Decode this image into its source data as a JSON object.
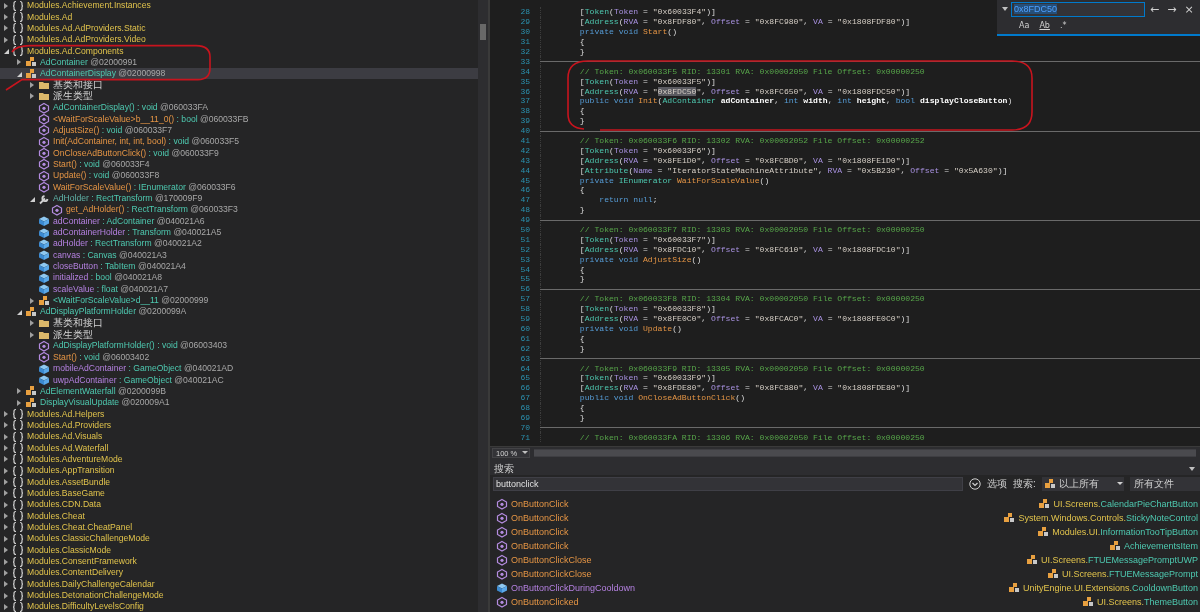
{
  "tree": [
    {
      "kind": "namespace",
      "name": "Modules.Achievement.Instances",
      "expanded": false,
      "selected": false
    },
    {
      "kind": "namespace",
      "name": "Modules.Ad",
      "expanded": false,
      "selected": false
    },
    {
      "kind": "namespace",
      "name": "Modules.Ad.AdProviders.Static",
      "expanded": false,
      "selected": false
    },
    {
      "kind": "namespace",
      "name": "Modules.Ad.AdProviders.Video",
      "expanded": false,
      "selected": false
    },
    {
      "kind": "namespace",
      "name": "Modules.Ad.Components",
      "expanded": true,
      "selected": false,
      "children": [
        {
          "kind": "class",
          "name": "AdContainer",
          "token": "@02000991",
          "expanded": false,
          "selected": false
        },
        {
          "kind": "class",
          "name": "AdContainerDisplay",
          "token": "@02000998",
          "expanded": true,
          "selected": true,
          "children": [
            {
              "kind": "folder",
              "name": "基类和接口",
              "expanded": false,
              "selected": false
            },
            {
              "kind": "folder",
              "name": "派生类型",
              "expanded": false,
              "selected": false
            },
            {
              "kind": "constructor",
              "name": "AdContainerDisplay()",
              "type": ": void",
              "token": "@060033FA",
              "selected": false
            },
            {
              "kind": "method",
              "name": "<WaitForScaleValue>b__11_0()",
              "type": ": bool",
              "token": "@060033FB",
              "selected": false
            },
            {
              "kind": "method",
              "name": "AdjustSize()",
              "type": ": void",
              "token": "@060033F7",
              "selected": false
            },
            {
              "kind": "method",
              "name": "Init(AdContainer, int, int, bool)",
              "type": ": void",
              "token": "@060033F5",
              "selected": false
            },
            {
              "kind": "method",
              "name": "OnCloseAdButtonClick()",
              "type": ": void",
              "token": "@060033F9",
              "selected": false
            },
            {
              "kind": "method",
              "name": "Start()",
              "type": ": void",
              "token": "@060033F4",
              "selected": false
            },
            {
              "kind": "method",
              "name": "Update()",
              "type": ": void",
              "token": "@060033F8",
              "selected": false
            },
            {
              "kind": "method",
              "name": "WaitForScaleValue()",
              "type": ": IEnumerator",
              "token": "@060033F6",
              "selected": false
            },
            {
              "kind": "property",
              "name": "AdHolder",
              "type": ": RectTransform",
              "token": "@170009F9",
              "expanded": true,
              "selected": false,
              "children": [
                {
                  "kind": "method",
                  "name": "get_AdHolder()",
                  "type": ": RectTransform",
                  "token": "@060033F3",
                  "selected": false
                }
              ]
            },
            {
              "kind": "field",
              "name": "adContainer",
              "type": ": AdContainer",
              "token": "@040021A6",
              "selected": false
            },
            {
              "kind": "field",
              "name": "adContainerHolder",
              "type": ": Transform",
              "token": "@040021A5",
              "selected": false
            },
            {
              "kind": "field",
              "name": "adHolder",
              "type": ": RectTransform",
              "token": "@040021A2",
              "selected": false
            },
            {
              "kind": "field",
              "name": "canvas",
              "type": ": Canvas",
              "token": "@040021A3",
              "selected": false
            },
            {
              "kind": "field",
              "name": "closeButton",
              "type": ": TabItem",
              "token": "@040021A4",
              "selected": false
            },
            {
              "kind": "field",
              "name": "initialized",
              "type": ": bool",
              "token": "@040021A8",
              "selected": false
            },
            {
              "kind": "field",
              "name": "scaleValue",
              "type": ": float",
              "token": "@040021A7",
              "selected": false
            },
            {
              "kind": "nested",
              "name": "<WaitForScaleValue>d__11",
              "token": "@02000999",
              "expanded": false,
              "selected": false
            }
          ]
        },
        {
          "kind": "class",
          "name": "AdDisplayPlatformHolder",
          "token": "@0200099A",
          "expanded": true,
          "selected": false,
          "children": [
            {
              "kind": "folder",
              "name": "基类和接口",
              "expanded": false,
              "selected": false
            },
            {
              "kind": "folder",
              "name": "派生类型",
              "expanded": false,
              "selected": false
            },
            {
              "kind": "constructor",
              "name": "AdDisplayPlatformHolder()",
              "type": ": void",
              "token": "@06003403",
              "selected": false
            },
            {
              "kind": "method",
              "name": "Start()",
              "type": ": void",
              "token": "@06003402",
              "selected": false
            },
            {
              "kind": "field",
              "name": "mobileAdContainer",
              "type": ": GameObject",
              "token": "@040021AD",
              "selected": false
            },
            {
              "kind": "field",
              "name": "uwpAdContainer",
              "type": ": GameObject",
              "token": "@040021AC",
              "selected": false
            }
          ]
        },
        {
          "kind": "class",
          "name": "AdElementWaterfall",
          "token": "@0200099B",
          "expanded": false,
          "selected": false
        },
        {
          "kind": "class",
          "name": "DisplayVisualUpdate",
          "token": "@020009A1",
          "expanded": false,
          "selected": false
        }
      ]
    },
    {
      "kind": "namespace",
      "name": "Modules.Ad.Helpers",
      "expanded": false,
      "selected": false
    },
    {
      "kind": "namespace",
      "name": "Modules.Ad.Providers",
      "expanded": false,
      "selected": false
    },
    {
      "kind": "namespace",
      "name": "Modules.Ad.Visuals",
      "expanded": false,
      "selected": false
    },
    {
      "kind": "namespace",
      "name": "Modules.Ad.Waterfall",
      "expanded": false,
      "selected": false
    },
    {
      "kind": "namespace",
      "name": "Modules.AdventureMode",
      "expanded": false,
      "selected": false
    },
    {
      "kind": "namespace",
      "name": "Modules.AppTransition",
      "expanded": false,
      "selected": false
    },
    {
      "kind": "namespace",
      "name": "Modules.AssetBundle",
      "expanded": false,
      "selected": false
    },
    {
      "kind": "namespace",
      "name": "Modules.BaseGame",
      "expanded": false,
      "selected": false
    },
    {
      "kind": "namespace",
      "name": "Modules.CDN.Data",
      "expanded": false,
      "selected": false
    },
    {
      "kind": "namespace",
      "name": "Modules.Cheat",
      "expanded": false,
      "selected": false
    },
    {
      "kind": "namespace",
      "name": "Modules.Cheat.CheatPanel",
      "expanded": false,
      "selected": false
    },
    {
      "kind": "namespace",
      "name": "Modules.ClassicChallengeMode",
      "expanded": false,
      "selected": false
    },
    {
      "kind": "namespace",
      "name": "Modules.ClassicMode",
      "expanded": false,
      "selected": false
    },
    {
      "kind": "namespace",
      "name": "Modules.ConsentFramework",
      "expanded": false,
      "selected": false
    },
    {
      "kind": "namespace",
      "name": "Modules.ContentDelivery",
      "expanded": false,
      "selected": false
    },
    {
      "kind": "namespace",
      "name": "Modules.DailyChallengeCalendar",
      "expanded": false,
      "selected": false
    },
    {
      "kind": "namespace",
      "name": "Modules.DetonationChallengeMode",
      "expanded": false,
      "selected": false
    },
    {
      "kind": "namespace",
      "name": "Modules.DifficultyLevelsConfig",
      "expanded": false,
      "selected": false
    }
  ],
  "code": {
    "lines": [
      {
        "number": "28",
        "tokens": [
          {
            "kind": "plain",
            "text": "        ["
          },
          {
            "kind": "type",
            "text": "Token"
          },
          {
            "kind": "plain",
            "text": "("
          },
          {
            "kind": "arg",
            "text": "Token"
          },
          {
            "kind": "plain",
            "text": " = "
          },
          {
            "kind": "string",
            "text": "\"0x60033F4\""
          },
          {
            "kind": "plain",
            "text": ")]"
          }
        ]
      },
      {
        "number": "29",
        "tokens": [
          {
            "kind": "plain",
            "text": "        ["
          },
          {
            "kind": "type",
            "text": "Address"
          },
          {
            "kind": "plain",
            "text": "("
          },
          {
            "kind": "arg",
            "text": "RVA"
          },
          {
            "kind": "plain",
            "text": " = "
          },
          {
            "kind": "string",
            "text": "\"0x8FDF80\""
          },
          {
            "kind": "plain",
            "text": ", "
          },
          {
            "kind": "arg",
            "text": "Offset"
          },
          {
            "kind": "plain",
            "text": " = "
          },
          {
            "kind": "string",
            "text": "\"0x8FC980\""
          },
          {
            "kind": "plain",
            "text": ", "
          },
          {
            "kind": "arg",
            "text": "VA"
          },
          {
            "kind": "plain",
            "text": " = "
          },
          {
            "kind": "string",
            "text": "\"0x1808FDF80\""
          },
          {
            "kind": "plain",
            "text": ")]"
          }
        ]
      },
      {
        "number": "30",
        "tokens": [
          {
            "kind": "keyword",
            "text": "        private void "
          },
          {
            "kind": "method",
            "text": "Start"
          },
          {
            "kind": "plain",
            "text": "()"
          }
        ]
      },
      {
        "number": "31",
        "tokens": [
          {
            "kind": "plain",
            "text": "        {"
          }
        ]
      },
      {
        "number": "32",
        "tokens": [
          {
            "kind": "plain",
            "text": "        }"
          }
        ]
      },
      {
        "number": "33",
        "separator": true
      },
      {
        "number": "34",
        "tokens": [
          {
            "kind": "comment",
            "text": "        // Token: 0x060033F5 RID: 13301 RVA: 0x00002050 File Offset: 0x00000250"
          }
        ]
      },
      {
        "number": "35",
        "tokens": [
          {
            "kind": "plain",
            "text": "        ["
          },
          {
            "kind": "type",
            "text": "Token"
          },
          {
            "kind": "plain",
            "text": "("
          },
          {
            "kind": "arg",
            "text": "Token"
          },
          {
            "kind": "plain",
            "text": " = "
          },
          {
            "kind": "string",
            "text": "\"0x60033F5\""
          },
          {
            "kind": "plain",
            "text": ")]"
          }
        ]
      },
      {
        "number": "36",
        "tokens": [
          {
            "kind": "plain",
            "text": "        ["
          },
          {
            "kind": "type",
            "text": "Address"
          },
          {
            "kind": "plain",
            "text": "("
          },
          {
            "kind": "arg",
            "text": "RVA"
          },
          {
            "kind": "plain",
            "text": " = "
          },
          {
            "kind": "string",
            "text": "\""
          },
          {
            "kind": "match",
            "text": "0x8FDC50"
          },
          {
            "kind": "string",
            "text": "\""
          },
          {
            "kind": "plain",
            "text": ", "
          },
          {
            "kind": "arg",
            "text": "Offset"
          },
          {
            "kind": "plain",
            "text": " = "
          },
          {
            "kind": "string",
            "text": "\"0x8FC650\""
          },
          {
            "kind": "plain",
            "text": ", "
          },
          {
            "kind": "arg",
            "text": "VA"
          },
          {
            "kind": "plain",
            "text": " = "
          },
          {
            "kind": "string",
            "text": "\"0x1808FDC50\""
          },
          {
            "kind": "plain",
            "text": ")]"
          }
        ]
      },
      {
        "number": "37",
        "tokens": [
          {
            "kind": "keyword",
            "text": "        public void "
          },
          {
            "kind": "method",
            "text": "Init"
          },
          {
            "kind": "plain",
            "text": "("
          },
          {
            "kind": "type",
            "text": "AdContainer"
          },
          {
            "kind": "param",
            "text": " adContainer"
          },
          {
            "kind": "plain",
            "text": ", "
          },
          {
            "kind": "keyword",
            "text": "int"
          },
          {
            "kind": "param",
            "text": " width"
          },
          {
            "kind": "plain",
            "text": ", "
          },
          {
            "kind": "keyword",
            "text": "int"
          },
          {
            "kind": "param",
            "text": " height"
          },
          {
            "kind": "plain",
            "text": ", "
          },
          {
            "kind": "keyword",
            "text": "bool"
          },
          {
            "kind": "param",
            "text": " displayCloseButton"
          },
          {
            "kind": "plain",
            "text": ")"
          }
        ]
      },
      {
        "number": "38",
        "tokens": [
          {
            "kind": "plain",
            "text": "        {"
          }
        ]
      },
      {
        "number": "39",
        "tokens": [
          {
            "kind": "plain",
            "text": "        }"
          }
        ]
      },
      {
        "number": "40",
        "separator": true
      },
      {
        "number": "41",
        "tokens": [
          {
            "kind": "comment",
            "text": "        // Token: 0x060033F6 RID: 13302 RVA: 0x00002052 File Offset: 0x00000252"
          }
        ]
      },
      {
        "number": "42",
        "tokens": [
          {
            "kind": "plain",
            "text": "        ["
          },
          {
            "kind": "type",
            "text": "Token"
          },
          {
            "kind": "plain",
            "text": "("
          },
          {
            "kind": "arg",
            "text": "Token"
          },
          {
            "kind": "plain",
            "text": " = "
          },
          {
            "kind": "string",
            "text": "\"0x60033F6\""
          },
          {
            "kind": "plain",
            "text": ")]"
          }
        ]
      },
      {
        "number": "43",
        "tokens": [
          {
            "kind": "plain",
            "text": "        ["
          },
          {
            "kind": "type",
            "text": "Address"
          },
          {
            "kind": "plain",
            "text": "("
          },
          {
            "kind": "arg",
            "text": "RVA"
          },
          {
            "kind": "plain",
            "text": " = "
          },
          {
            "kind": "string",
            "text": "\"0x8FE1D0\""
          },
          {
            "kind": "plain",
            "text": ", "
          },
          {
            "kind": "arg",
            "text": "Offset"
          },
          {
            "kind": "plain",
            "text": " = "
          },
          {
            "kind": "string",
            "text": "\"0x8FCBD0\""
          },
          {
            "kind": "plain",
            "text": ", "
          },
          {
            "kind": "arg",
            "text": "VA"
          },
          {
            "kind": "plain",
            "text": " = "
          },
          {
            "kind": "string",
            "text": "\"0x1808FE1D0\""
          },
          {
            "kind": "plain",
            "text": ")]"
          }
        ]
      },
      {
        "number": "44",
        "tokens": [
          {
            "kind": "plain",
            "text": "        ["
          },
          {
            "kind": "type",
            "text": "Attribute"
          },
          {
            "kind": "plain",
            "text": "("
          },
          {
            "kind": "arg",
            "text": "Name"
          },
          {
            "kind": "plain",
            "text": " = "
          },
          {
            "kind": "string",
            "text": "\"IteratorStateMachineAttribute\""
          },
          {
            "kind": "plain",
            "text": ", "
          },
          {
            "kind": "arg",
            "text": "RVA"
          },
          {
            "kind": "plain",
            "text": " = "
          },
          {
            "kind": "string",
            "text": "\"0x5B230\""
          },
          {
            "kind": "plain",
            "text": ", "
          },
          {
            "kind": "arg",
            "text": "Offset"
          },
          {
            "kind": "plain",
            "text": " = "
          },
          {
            "kind": "string",
            "text": "\"0x5A630\""
          },
          {
            "kind": "plain",
            "text": ")]"
          }
        ]
      },
      {
        "number": "45",
        "tokens": [
          {
            "kind": "keyword",
            "text": "        private "
          },
          {
            "kind": "type",
            "text": "IEnumerator "
          },
          {
            "kind": "method",
            "text": "WaitForScaleValue"
          },
          {
            "kind": "plain",
            "text": "()"
          }
        ]
      },
      {
        "number": "46",
        "tokens": [
          {
            "kind": "plain",
            "text": "        {"
          }
        ]
      },
      {
        "number": "47",
        "tokens": [
          {
            "kind": "keyword",
            "text": "            return null"
          },
          {
            "kind": "plain",
            "text": ";"
          }
        ]
      },
      {
        "number": "48",
        "tokens": [
          {
            "kind": "plain",
            "text": "        }"
          }
        ]
      },
      {
        "number": "49",
        "separator": true
      },
      {
        "number": "50",
        "tokens": [
          {
            "kind": "comment",
            "text": "        // Token: 0x060033F7 RID: 13303 RVA: 0x00002050 File Offset: 0x00000250"
          }
        ]
      },
      {
        "number": "51",
        "tokens": [
          {
            "kind": "plain",
            "text": "        ["
          },
          {
            "kind": "type",
            "text": "Token"
          },
          {
            "kind": "plain",
            "text": "("
          },
          {
            "kind": "arg",
            "text": "Token"
          },
          {
            "kind": "plain",
            "text": " = "
          },
          {
            "kind": "string",
            "text": "\"0x60033F7\""
          },
          {
            "kind": "plain",
            "text": ")]"
          }
        ]
      },
      {
        "number": "52",
        "tokens": [
          {
            "kind": "plain",
            "text": "        ["
          },
          {
            "kind": "type",
            "text": "Address"
          },
          {
            "kind": "plain",
            "text": "("
          },
          {
            "kind": "arg",
            "text": "RVA"
          },
          {
            "kind": "plain",
            "text": " = "
          },
          {
            "kind": "string",
            "text": "\"0x8FDC10\""
          },
          {
            "kind": "plain",
            "text": ", "
          },
          {
            "kind": "arg",
            "text": "Offset"
          },
          {
            "kind": "plain",
            "text": " = "
          },
          {
            "kind": "string",
            "text": "\"0x8FC610\""
          },
          {
            "kind": "plain",
            "text": ", "
          },
          {
            "kind": "arg",
            "text": "VA"
          },
          {
            "kind": "plain",
            "text": " = "
          },
          {
            "kind": "string",
            "text": "\"0x1808FDC10\""
          },
          {
            "kind": "plain",
            "text": ")]"
          }
        ]
      },
      {
        "number": "53",
        "tokens": [
          {
            "kind": "keyword",
            "text": "        private void "
          },
          {
            "kind": "method",
            "text": "AdjustSize"
          },
          {
            "kind": "plain",
            "text": "()"
          }
        ]
      },
      {
        "number": "54",
        "tokens": [
          {
            "kind": "plain",
            "text": "        {"
          }
        ]
      },
      {
        "number": "55",
        "tokens": [
          {
            "kind": "plain",
            "text": "        }"
          }
        ]
      },
      {
        "number": "56",
        "separator": true
      },
      {
        "number": "57",
        "tokens": [
          {
            "kind": "comment",
            "text": "        // Token: 0x060033F8 RID: 13304 RVA: 0x00002050 File Offset: 0x00000250"
          }
        ]
      },
      {
        "number": "58",
        "tokens": [
          {
            "kind": "plain",
            "text": "        ["
          },
          {
            "kind": "type",
            "text": "Token"
          },
          {
            "kind": "plain",
            "text": "("
          },
          {
            "kind": "arg",
            "text": "Token"
          },
          {
            "kind": "plain",
            "text": " = "
          },
          {
            "kind": "string",
            "text": "\"0x60033F8\""
          },
          {
            "kind": "plain",
            "text": ")]"
          }
        ]
      },
      {
        "number": "59",
        "tokens": [
          {
            "kind": "plain",
            "text": "        ["
          },
          {
            "kind": "type",
            "text": "Address"
          },
          {
            "kind": "plain",
            "text": "("
          },
          {
            "kind": "arg",
            "text": "RVA"
          },
          {
            "kind": "plain",
            "text": " = "
          },
          {
            "kind": "string",
            "text": "\"0x8FE0C0\""
          },
          {
            "kind": "plain",
            "text": ", "
          },
          {
            "kind": "arg",
            "text": "Offset"
          },
          {
            "kind": "plain",
            "text": " = "
          },
          {
            "kind": "string",
            "text": "\"0x8FCAC0\""
          },
          {
            "kind": "plain",
            "text": ", "
          },
          {
            "kind": "arg",
            "text": "VA"
          },
          {
            "kind": "plain",
            "text": " = "
          },
          {
            "kind": "string",
            "text": "\"0x1808FE0C0\""
          },
          {
            "kind": "plain",
            "text": ")]"
          }
        ]
      },
      {
        "number": "60",
        "tokens": [
          {
            "kind": "keyword",
            "text": "        private void "
          },
          {
            "kind": "method",
            "text": "Update"
          },
          {
            "kind": "plain",
            "text": "()"
          }
        ]
      },
      {
        "number": "61",
        "tokens": [
          {
            "kind": "plain",
            "text": "        {"
          }
        ]
      },
      {
        "number": "62",
        "tokens": [
          {
            "kind": "plain",
            "text": "        }"
          }
        ]
      },
      {
        "number": "63",
        "separator": true
      },
      {
        "number": "64",
        "tokens": [
          {
            "kind": "comment",
            "text": "        // Token: 0x060033F9 RID: 13305 RVA: 0x00002050 File Offset: 0x00000250"
          }
        ]
      },
      {
        "number": "65",
        "tokens": [
          {
            "kind": "plain",
            "text": "        ["
          },
          {
            "kind": "type",
            "text": "Token"
          },
          {
            "kind": "plain",
            "text": "("
          },
          {
            "kind": "arg",
            "text": "Token"
          },
          {
            "kind": "plain",
            "text": " = "
          },
          {
            "kind": "string",
            "text": "\"0x60033F9\""
          },
          {
            "kind": "plain",
            "text": ")]"
          }
        ]
      },
      {
        "number": "66",
        "tokens": [
          {
            "kind": "plain",
            "text": "        ["
          },
          {
            "kind": "type",
            "text": "Address"
          },
          {
            "kind": "plain",
            "text": "("
          },
          {
            "kind": "arg",
            "text": "RVA"
          },
          {
            "kind": "plain",
            "text": " = "
          },
          {
            "kind": "string",
            "text": "\"0x8FDE80\""
          },
          {
            "kind": "plain",
            "text": ", "
          },
          {
            "kind": "arg",
            "text": "Offset"
          },
          {
            "kind": "plain",
            "text": " = "
          },
          {
            "kind": "string",
            "text": "\"0x8FC880\""
          },
          {
            "kind": "plain",
            "text": ", "
          },
          {
            "kind": "arg",
            "text": "VA"
          },
          {
            "kind": "plain",
            "text": " = "
          },
          {
            "kind": "string",
            "text": "\"0x1808FDE80\""
          },
          {
            "kind": "plain",
            "text": ")]"
          }
        ]
      },
      {
        "number": "67",
        "tokens": [
          {
            "kind": "keyword",
            "text": "        public void "
          },
          {
            "kind": "method",
            "text": "OnCloseAdButtonClick"
          },
          {
            "kind": "plain",
            "text": "()"
          }
        ]
      },
      {
        "number": "68",
        "tokens": [
          {
            "kind": "plain",
            "text": "        {"
          }
        ]
      },
      {
        "number": "69",
        "tokens": [
          {
            "kind": "plain",
            "text": "        }"
          }
        ]
      },
      {
        "number": "70",
        "separator": true
      },
      {
        "number": "71",
        "tokens": [
          {
            "kind": "comment",
            "text": "        // Token: 0x060033FA RID: 13306 RVA: 0x00002050 File Offset: 0x00000250"
          }
        ]
      }
    ],
    "zoom": "100 %"
  },
  "find": {
    "value": "0x8FDC50",
    "buttons": [
      "←",
      "→",
      "×"
    ],
    "options": [
      "Aa",
      "Ab",
      ".*"
    ]
  },
  "search": {
    "title": "搜索",
    "query": "buttonclick",
    "options_label": "选项",
    "scope_label": "搜索:",
    "scope": "以上所有",
    "files": "所有文件",
    "results": [
      {
        "kind": "method",
        "name": "OnButtonClick",
        "namespace": "UI.Screens.",
        "type": "CalendarPieChartButton"
      },
      {
        "kind": "method",
        "name": "OnButtonClick",
        "namespace": "System.Windows.Controls.",
        "type": "StickyNoteControl"
      },
      {
        "kind": "method",
        "name": "OnButtonClick",
        "namespace": "Modules.UI.",
        "type": "InformationTooTipButton"
      },
      {
        "kind": "method",
        "name": "OnButtonClick",
        "type": "AchievementsItem"
      },
      {
        "kind": "method",
        "name": "OnButtonClickClose",
        "namespace": "UI.Screens.",
        "type": "FTUEMessagePromptUWP"
      },
      {
        "kind": "method",
        "name": "OnButtonClickClose",
        "namespace": "UI.Screens.",
        "type": "FTUEMessagePrompt"
      },
      {
        "kind": "field",
        "name": "OnButtonClickDuringCooldown",
        "namespace": "UnityEngine.UI.Extensions.",
        "type": "CooldownButton"
      },
      {
        "kind": "method",
        "name": "OnButtonClicked",
        "namespace": "UI.Screens.",
        "type": "ThemeButton"
      }
    ]
  },
  "marks": [
    {
      "color": "#c8141e"
    },
    {
      "color": "#c8141e"
    }
  ]
}
